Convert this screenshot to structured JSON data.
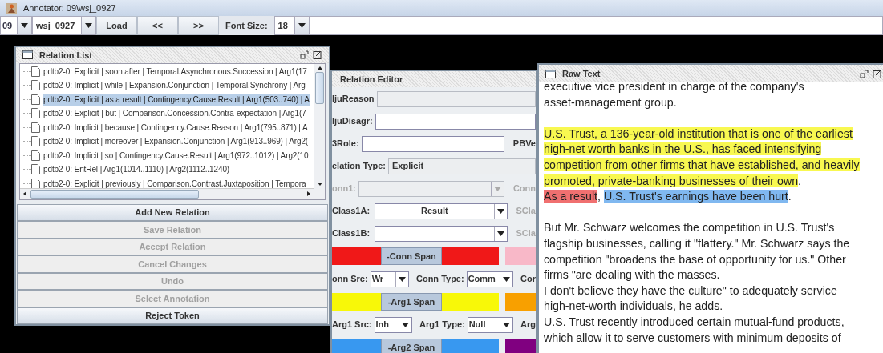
{
  "window": {
    "title": "Annotator:  09\\wsj_0927"
  },
  "toolbar": {
    "section": "09",
    "file": "wsj_0927",
    "buttons": [
      "Load",
      "<<",
      ">>"
    ],
    "font_size_label": "Font Size:",
    "font_size": "18"
  },
  "relation_list": {
    "title": "Relation List",
    "items": [
      {
        "text": "pdtb2-0: Explicit | soon after | Temporal.Asynchronous.Succession | Arg1(17",
        "selected": false
      },
      {
        "text": "pdtb2-0: Implicit | while | Expansion.Conjunction | Temporal.Synchrony | Arg",
        "selected": false
      },
      {
        "text": "pdtb2-0: Explicit | as a result | Contingency.Cause.Result | Arg1(503..740) | A",
        "selected": true
      },
      {
        "text": "pdtb2-0: Explicit | but | Comparison.Concession.Contra-expectation | Arg1(7",
        "selected": false
      },
      {
        "text": "pdtb2-0: Implicit | because | Contingency.Cause.Reason | Arg1(795..871) | A",
        "selected": false
      },
      {
        "text": "pdtb2-0: Implicit | moreover | Expansion.Conjunction | Arg1(913..969) | Arg2(",
        "selected": false
      },
      {
        "text": "pdtb2-0: Implicit | so | Contingency.Cause.Result | Arg1(972..1012) | Arg2(10",
        "selected": false
      },
      {
        "text": "pdtb2-0: EntRel | Arg1(1014..1110) | Arg2(1112..1240)",
        "selected": false
      },
      {
        "text": "pdtb2-0: Explicit | previously | Comparison.Contrast.Juxtaposition | Tempora",
        "selected": false
      }
    ],
    "buttons": [
      {
        "label": "Add New Relation",
        "disabled": false
      },
      {
        "label": "Save Relation",
        "disabled": true
      },
      {
        "label": "Accept Relation",
        "disabled": true
      },
      {
        "label": "Cancel Changes",
        "disabled": true
      },
      {
        "label": "Undo",
        "disabled": true
      },
      {
        "label": "Select Annotation",
        "disabled": true
      },
      {
        "label": "Reject Token",
        "disabled": false
      }
    ]
  },
  "relation_editor": {
    "title": "Relation Editor",
    "rows": [
      {
        "kind": "field",
        "label": "ljuReason",
        "value": "",
        "disabled": true
      },
      {
        "kind": "field",
        "label": "ljuDisagr:",
        "value": "",
        "disabled": false
      },
      {
        "kind": "field",
        "label": "3Role:",
        "value": "",
        "disabled": false,
        "side_label": "PBVe"
      },
      {
        "kind": "field",
        "label": "elation Type:",
        "value": "Explicit",
        "disabled": true
      },
      {
        "kind": "combo",
        "label": "onn1:",
        "value": "",
        "disabled": true,
        "side_label": "Conn"
      },
      {
        "kind": "combo",
        "label": "Class1A:",
        "value": "Result",
        "disabled": false,
        "side_label": "SCla"
      },
      {
        "kind": "combo",
        "label": "Class1B:",
        "value": "",
        "disabled": false,
        "side_label": "SCla"
      },
      {
        "kind": "span",
        "label": "-Conn Span",
        "swatches": [
          {
            "color": "#f01818"
          },
          {
            "color": "#f01818"
          },
          {
            "color": "#f8b8c8"
          }
        ]
      },
      {
        "kind": "pair",
        "label": "onn Src:",
        "value": "Wr",
        "label2": "Conn Type:",
        "value2": "Comm",
        "side_label": "Cor"
      },
      {
        "kind": "span",
        "label": "-Arg1 Span",
        "swatches": [
          {
            "color": "#f8f808"
          },
          {
            "color": "#f8f808"
          },
          {
            "color": "#f8a000"
          }
        ]
      },
      {
        "kind": "pair",
        "label": "Arg1 Src:",
        "value": "Inh",
        "label2": "Arg1 Type:",
        "value2": "Null",
        "side_label": "Arg"
      },
      {
        "kind": "span",
        "label": "-Arg2 Span",
        "swatches": [
          {
            "color": "#3898f0"
          },
          {
            "color": "#3898f0"
          },
          {
            "color": "#800080"
          }
        ]
      }
    ]
  },
  "raw_text": {
    "title": "Raw Text",
    "paragraphs": [
      [
        [
          {
            "text": "executive vice president in charge of the company's",
            "kind": "plain"
          }
        ],
        [
          {
            "text": "asset-management group.",
            "kind": "plain"
          }
        ]
      ],
      [
        [
          {
            "text": "U.S. Trust, a 136-year-old institution that is one of the earliest",
            "kind": "arg1"
          }
        ],
        [
          {
            "text": "high-net worth banks in the U.S., has faced intensifying",
            "kind": "arg1"
          }
        ],
        [
          {
            "text": "competition from other firms that have established, and heavily",
            "kind": "arg1"
          }
        ],
        [
          {
            "text": "promoted, private-banking businesses of their own",
            "kind": "arg1"
          },
          {
            "text": ".",
            "kind": "plain"
          }
        ],
        [
          {
            "text": "As a result",
            "kind": "conn"
          },
          {
            "text": ", ",
            "kind": "plain"
          },
          {
            "text": "U.S. Trust's earnings have been hurt",
            "kind": "arg2"
          },
          {
            "text": ".",
            "kind": "plain"
          }
        ]
      ],
      [
        [
          {
            "text": "But Mr. Schwarz welcomes the competition in U.S. Trust's",
            "kind": "plain"
          }
        ],
        [
          {
            "text": "flagship businesses, calling it \"flattery.\" Mr. Schwarz says the",
            "kind": "plain"
          }
        ],
        [
          {
            "text": "competition \"broadens the base of opportunity for us.\" Other",
            "kind": "plain"
          }
        ],
        [
          {
            "text": "firms \"are dealing with the masses.",
            "kind": "plain"
          }
        ],
        [
          {
            "text": "I don't believe they have the culture\" to adequately service",
            "kind": "plain"
          }
        ],
        [
          {
            "text": "high-net-worth individuals, he adds.",
            "kind": "plain"
          }
        ],
        [
          {
            "text": "U.S. Trust recently introduced certain mutual-fund products,",
            "kind": "plain"
          }
        ],
        [
          {
            "text": "which allow it to serve customers with minimum deposits of",
            "kind": "plain"
          }
        ]
      ]
    ]
  }
}
